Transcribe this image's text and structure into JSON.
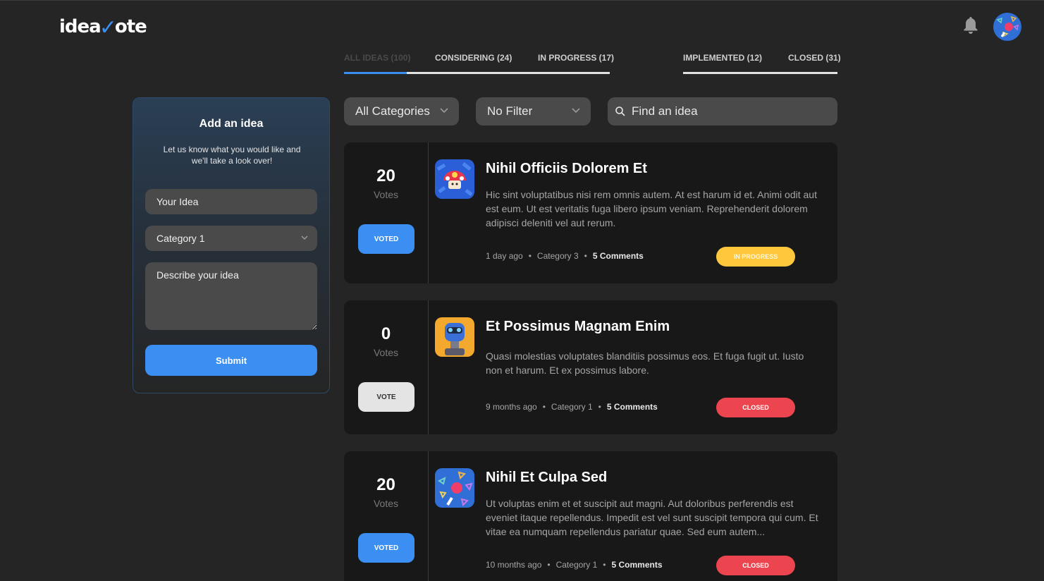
{
  "app": {
    "logo_prefix": "idea",
    "logo_suffix": "ote"
  },
  "icons": {
    "bell": "bell-icon",
    "chevron": "chevron-down-icon",
    "search": "search-icon"
  },
  "colors": {
    "accent": "#3b8ff3",
    "in_progress": "#ffc73c",
    "closed": "#ec454f",
    "background": "#252525",
    "card": "#181818"
  },
  "tabs": [
    {
      "label": "ALL IDEAS (100)",
      "active": true
    },
    {
      "label": "CONSIDERING (24)",
      "active": false
    },
    {
      "label": "IN PROGRESS (17)",
      "active": false
    },
    {
      "label": "IMPLEMENTED (12)",
      "active": false
    },
    {
      "label": "CLOSED (31)",
      "active": false
    }
  ],
  "filters": {
    "category": "All Categories",
    "status": "No Filter",
    "search_placeholder": "Find an idea"
  },
  "add_idea": {
    "title": "Add an idea",
    "subtitle": "Let us know what you would like and we'll take a look over!",
    "idea_placeholder": "Your Idea",
    "category_value": "Category 1",
    "description_placeholder": "Describe your idea",
    "submit_label": "Submit"
  },
  "ideas": [
    {
      "votes": "20",
      "votes_label": "Votes",
      "vote_button": "VOTED",
      "title": "Nihil Officiis Dolorem Et",
      "description": "Hic sint voluptatibus nisi rem omnis autem. At est harum id et. Animi odit aut est eum. Ut est veritatis fuga libero ipsum veniam. Reprehenderit dolorem adipisci deleniti vel aut rerum.",
      "time": "1 day ago",
      "category": "Category 3",
      "comments": "5 Comments",
      "status": "IN PROGRESS"
    },
    {
      "votes": "0",
      "votes_label": "Votes",
      "vote_button": "VOTE",
      "title": "Et Possimus Magnam Enim",
      "description": "Quasi molestias voluptates blanditiis possimus eos. Et fuga fugit ut. Iusto non et harum. Et ex possimus labore.",
      "time": "9 months ago",
      "category": "Category 1",
      "comments": "5 Comments",
      "status": "CLOSED"
    },
    {
      "votes": "20",
      "votes_label": "Votes",
      "vote_button": "VOTED",
      "title": "Nihil Et Culpa Sed",
      "description": "Ut voluptas enim et et suscipit aut magni. Aut doloribus perferendis est eveniet itaque repellendus. Impedit est vel sunt suscipit tempora qui cum. Et vitae ea numquam repellendus pariatur quae. Sed eum autem...",
      "time": "10 months ago",
      "category": "Category 1",
      "comments": "5 Comments",
      "status": "CLOSED"
    }
  ]
}
